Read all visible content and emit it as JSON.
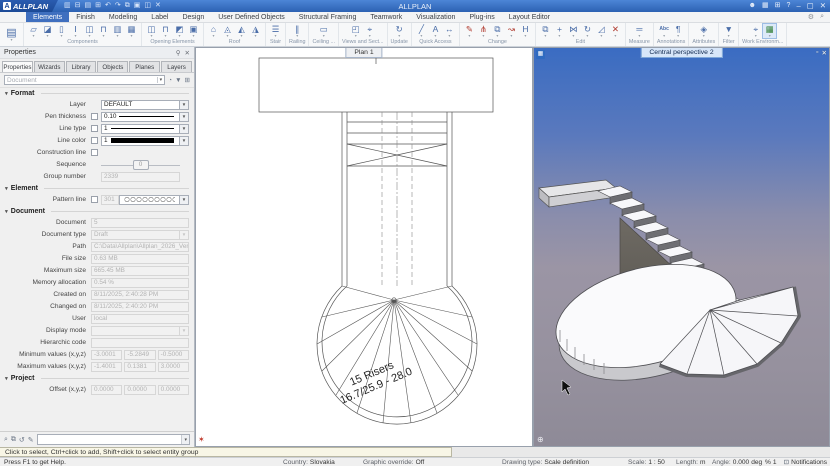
{
  "title_bar": {
    "logo_text": "ALLPLAN",
    "center_title": "ALLPLAN",
    "qat_icons": [
      {
        "name": "new-document-icon",
        "glyph": "▥"
      },
      {
        "name": "open-project-icon",
        "glyph": "⊟"
      },
      {
        "name": "save-icon",
        "glyph": "▤"
      },
      {
        "name": "print-icon",
        "glyph": "⊞"
      },
      {
        "name": "undo-icon",
        "glyph": "↶"
      },
      {
        "name": "redo-icon",
        "glyph": "↷"
      },
      {
        "name": "copy-icon",
        "glyph": "⧉"
      },
      {
        "name": "paste-icon",
        "glyph": "▣"
      },
      {
        "name": "window-layout-icon",
        "glyph": "◫"
      },
      {
        "name": "delete-icon",
        "glyph": "✕"
      }
    ],
    "icons": {
      "user": "☻",
      "panels": "▦",
      "shop": "⊞",
      "help": "?",
      "minimize": "–",
      "restore": "▢",
      "close": "✕"
    }
  },
  "menu": {
    "tabs": [
      {
        "label": "Elements",
        "active": true
      },
      {
        "label": "Finish"
      },
      {
        "label": "Modeling"
      },
      {
        "label": "Label"
      },
      {
        "label": "Design"
      },
      {
        "label": "User Defined Objects"
      },
      {
        "label": "Structural Framing"
      },
      {
        "label": "Teamwork"
      },
      {
        "label": "Visualization"
      },
      {
        "label": "Plug-ins"
      },
      {
        "label": "Layout Editor"
      }
    ],
    "right_icons": {
      "gear": "⚙",
      "search": "⌕"
    }
  },
  "ribbon": {
    "icon_color": "#4a6da8",
    "palette_icon": {
      "name": "properties-palette",
      "glyph": "▤"
    },
    "groups": [
      {
        "label": "Components",
        "icons": [
          {
            "name": "wall",
            "glyph": "▱"
          },
          {
            "name": "wall-line",
            "glyph": "◪"
          },
          {
            "name": "column",
            "glyph": "▯"
          },
          {
            "name": "downstand-beam",
            "glyph": "Ⅰ"
          },
          {
            "name": "upstand-beam",
            "glyph": "◫"
          },
          {
            "name": "wall-opening",
            "glyph": "⊓"
          },
          {
            "name": "recess",
            "glyph": "▥"
          },
          {
            "name": "smart-wall",
            "glyph": "▦"
          }
        ]
      },
      {
        "label": "Opening Elements",
        "icons": [
          {
            "name": "door",
            "glyph": "◫"
          },
          {
            "name": "window",
            "glyph": "⊓"
          },
          {
            "name": "french-window",
            "glyph": "◩"
          },
          {
            "name": "niche",
            "glyph": "▣"
          }
        ]
      },
      {
        "label": "Roof",
        "icons": [
          {
            "name": "roof-plane",
            "glyph": "⌂"
          },
          {
            "name": "roof-covering",
            "glyph": "◬"
          },
          {
            "name": "dormer",
            "glyph": "◭"
          },
          {
            "name": "skylight",
            "glyph": "◮"
          }
        ]
      },
      {
        "label": "Stair",
        "icons": [
          {
            "name": "stair",
            "glyph": "☰"
          }
        ]
      },
      {
        "label": "Railing",
        "icons": [
          {
            "name": "railing",
            "glyph": "∥"
          }
        ]
      },
      {
        "label": "Ceiling ...",
        "icons": [
          {
            "name": "ceiling",
            "glyph": "▭"
          }
        ]
      },
      {
        "label": "Views and Sect...",
        "icons": [
          {
            "name": "view",
            "glyph": "◰"
          },
          {
            "name": "section",
            "glyph": "⌖"
          }
        ]
      },
      {
        "label": "Update",
        "icons": [
          {
            "name": "update-3d",
            "glyph": "↻"
          }
        ]
      },
      {
        "label": "Quick Access",
        "icons": [
          {
            "name": "line",
            "glyph": "╱"
          },
          {
            "name": "text",
            "glyph": "A"
          },
          {
            "name": "dimension",
            "glyph": "↔"
          }
        ]
      },
      {
        "label": "Change",
        "icons": [
          {
            "name": "modify",
            "glyph": "✎",
            "color": "#b03a2e"
          },
          {
            "name": "split",
            "glyph": "⋔",
            "color": "#b03a2e"
          },
          {
            "name": "edit-copy",
            "glyph": "⧉"
          },
          {
            "name": "stretch",
            "glyph": "↝",
            "color": "#b03a2e"
          },
          {
            "name": "match",
            "glyph": "H"
          }
        ]
      },
      {
        "label": "Edit",
        "icons": [
          {
            "name": "copy",
            "glyph": "⧉"
          },
          {
            "name": "move",
            "glyph": "+"
          },
          {
            "name": "mirror",
            "glyph": "⋈"
          },
          {
            "name": "rotate",
            "glyph": "↻"
          },
          {
            "name": "resize",
            "glyph": "◿"
          },
          {
            "name": "delete",
            "glyph": "✕",
            "color": "#b03a2e"
          }
        ]
      },
      {
        "label": "Measure",
        "icons": [
          {
            "name": "measure",
            "glyph": "═"
          }
        ]
      },
      {
        "label": "Annotations",
        "icons": [
          {
            "name": "text-abc",
            "glyph": "Abc",
            "txt": true
          },
          {
            "name": "label",
            "glyph": "¶"
          }
        ]
      },
      {
        "label": "Attributes",
        "icons": [
          {
            "name": "attributes",
            "glyph": "◈"
          }
        ]
      },
      {
        "label": "Filter",
        "icons": [
          {
            "name": "filter",
            "glyph": "▼"
          }
        ]
      },
      {
        "label": "Work Environm...",
        "icons": [
          {
            "name": "workspace",
            "glyph": "⌖"
          },
          {
            "name": "work-environment",
            "glyph": "▦",
            "color": "#2e7d32",
            "sel": true
          }
        ]
      }
    ]
  },
  "properties": {
    "title": "Properties",
    "pin_icon": "⚲",
    "close_icon": "✕",
    "tabs": [
      "Properties",
      "Wizards",
      "Library",
      "Objects",
      "Planes",
      "Layers"
    ],
    "filter_placeholder": "Document",
    "filter_icons": {
      "match": "◔",
      "funnel": "▼",
      "dialog": "⊞"
    },
    "format": {
      "title": "Format",
      "layer_label": "Layer",
      "layer_value": "DEFAULT",
      "pen_label": "Pen thickness",
      "pen_value": "0.10",
      "linetype_label": "Line type",
      "linetype_value": "1",
      "linecolor_label": "Line color",
      "linecolor_value": "1",
      "construction_label": "Construction line",
      "sequence_label": "Sequence",
      "sequence_value": "0",
      "group_label": "Group number",
      "group_value": "2339"
    },
    "element": {
      "title": "Element",
      "pattern_label": "Pattern line",
      "pattern_value": "301"
    },
    "document": {
      "title": "Document",
      "rows": [
        {
          "key": "document",
          "label": "Document",
          "value": "5"
        },
        {
          "key": "document-type",
          "label": "Document type",
          "value": "Draft",
          "dropdown": true
        },
        {
          "key": "path",
          "label": "Path",
          "value": "C:\\Data\\Allplan\\Allplan_2026_Verification"
        },
        {
          "key": "file-size",
          "label": "File size",
          "value": "0.63 MB"
        },
        {
          "key": "maximum-size",
          "label": "Maximum size",
          "value": "665.45 MB"
        },
        {
          "key": "memory-allocation",
          "label": "Memory allocation",
          "value": "0.54 %"
        },
        {
          "key": "created-on",
          "label": "Created on",
          "value": "8/11/2025, 2:40:28 PM"
        },
        {
          "key": "changed-on",
          "label": "Changed on",
          "value": "8/11/2025, 2:40:20 PM"
        },
        {
          "key": "user",
          "label": "User",
          "value": "local"
        },
        {
          "key": "display-mode",
          "label": "Display mode",
          "value": "",
          "dropdown": true
        },
        {
          "key": "hierarchic-code",
          "label": "Hierarchic code",
          "value": ""
        }
      ],
      "min_label": "Minimum values (x,y,z)",
      "min_values": [
        "-3.0001",
        "-5.2849",
        "-0.5000"
      ],
      "max_label": "Maximum values (x,y,z)",
      "max_values": [
        "-1.4001",
        "0.1381",
        "3.0000"
      ]
    },
    "project": {
      "title": "Project",
      "offset_label": "Offset (x,y,z)",
      "offset_values": [
        "0.0000",
        "0.0000",
        "0.0000"
      ]
    },
    "bottom_icons": [
      {
        "name": "dialog-line-edit-icon",
        "glyph": "✎"
      },
      {
        "name": "dialog-line-repeat-icon",
        "glyph": "↺"
      },
      {
        "name": "dialog-line-clipboard-icon",
        "glyph": "⧉"
      },
      {
        "name": "dialog-line-zoom-icon",
        "glyph": "⌕"
      }
    ]
  },
  "plan_view": {
    "tab": "Plan 1",
    "annotation_line1": "15 Risers",
    "annotation_line2": "16.7/25.9 - 28.0",
    "compass_icon": "✶"
  },
  "perspective_view": {
    "tab": "Central perspective 2",
    "menu_icon": "▦",
    "restore_icon": "▫",
    "close_icon": "✕",
    "globe_icon": "⊕",
    "sky_top_color": "#3a6cc2",
    "sky_bottom_color": "#8e8a97"
  },
  "prompt_bar": {
    "text": "Click to select, Ctrl+click to add, Shift+click to select entity group"
  },
  "status_bar": {
    "help": "Press F1 to get Help.",
    "country_label": "Country:",
    "country": "Slovakia",
    "override_label": "Graphic override:",
    "override_value": "Off",
    "drawing_label": "Drawing type:",
    "drawing_value": "Scale definition",
    "scale_label": "Scale:",
    "scale_value": "1 : 50",
    "length_label": "Length:",
    "length_value": "m",
    "angle_label": "Angle:",
    "angle_value": "0.000",
    "angle_unit": "deg",
    "slope_unit": "%",
    "slope_value": "1",
    "notifications": "Notifications",
    "notifications_icon": "⊡"
  }
}
